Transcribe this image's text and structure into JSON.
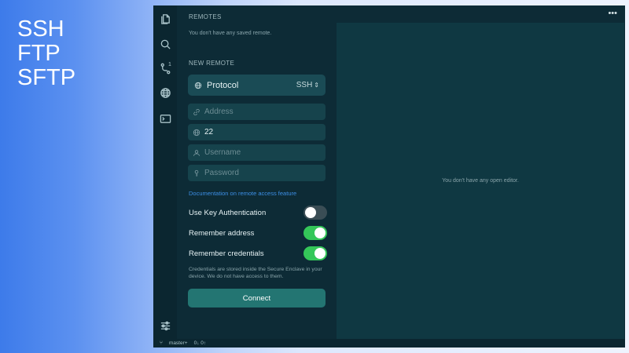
{
  "promo": {
    "line1": "SSH",
    "line2": "FTP",
    "line3": "SFTP"
  },
  "activity_bar": {
    "items": [
      {
        "icon": "files-icon"
      },
      {
        "icon": "search-icon"
      },
      {
        "icon": "source-control-icon",
        "badge": "1"
      },
      {
        "icon": "globe-icon"
      },
      {
        "icon": "terminal-icon"
      },
      {
        "icon": "settings-sliders-icon"
      }
    ]
  },
  "remotes": {
    "title": "REMOTES",
    "empty_text": "You don't have any saved remote."
  },
  "new_remote": {
    "title": "NEW REMOTE",
    "protocol_label": "Protocol",
    "protocol_value": "SSH",
    "address_placeholder": "Address",
    "port_value": "22",
    "username_placeholder": "Username",
    "password_placeholder": "Password",
    "doc_link": "Documentation on remote access feature",
    "toggles": [
      {
        "label": "Use Key Authentication",
        "on": false
      },
      {
        "label": "Remember address",
        "on": true
      },
      {
        "label": "Remember credentials",
        "on": true
      }
    ],
    "note": "Credentials are stored inside the Secure Enclave in your device. We do not have access to them.",
    "connect_label": "Connect"
  },
  "editor": {
    "empty_text": "You don't have any open editor.",
    "more_label": "•••"
  },
  "status_bar": {
    "branch": "master+",
    "sync": "0↓ 0↑"
  },
  "colors": {
    "window_bg": "#0d2b36",
    "editor_bg": "#0f3842",
    "toggle_on": "#34c759",
    "connect_bg": "#237572",
    "link": "#3c8fe6"
  }
}
